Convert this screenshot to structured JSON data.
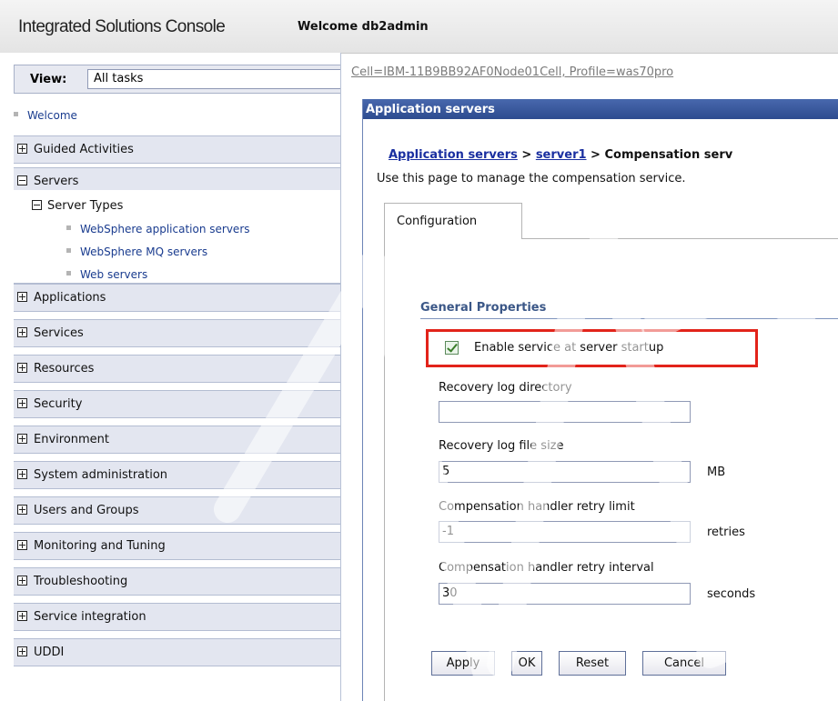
{
  "header": {
    "app_title": "Integrated Solutions Console",
    "welcome": "Welcome db2admin"
  },
  "nav": {
    "view_label": "View:",
    "view_value": "All tasks",
    "welcome_link": "Welcome",
    "groups": [
      {
        "label": "Guided Activities",
        "expanded": false
      },
      {
        "label": "Servers",
        "expanded": true
      },
      {
        "label": "Applications",
        "expanded": false
      },
      {
        "label": "Services",
        "expanded": false
      },
      {
        "label": "Resources",
        "expanded": false
      },
      {
        "label": "Security",
        "expanded": false
      },
      {
        "label": "Environment",
        "expanded": false
      },
      {
        "label": "System administration",
        "expanded": false
      },
      {
        "label": "Users and Groups",
        "expanded": false
      },
      {
        "label": "Monitoring and Tuning",
        "expanded": false
      },
      {
        "label": "Troubleshooting",
        "expanded": false
      },
      {
        "label": "Service integration",
        "expanded": false
      },
      {
        "label": "UDDI",
        "expanded": false
      }
    ],
    "server_types": {
      "label": "Server Types",
      "items": [
        "WebSphere application servers",
        "WebSphere MQ servers",
        "Web servers"
      ]
    }
  },
  "main": {
    "cell_path": "Cell=IBM-11B9BB92AF0Node01Cell, Profile=was70pro",
    "panel_title": "Application servers",
    "trail": {
      "link1": "Application servers",
      "sep1": " > ",
      "link2": "server1",
      "sep2": " > ",
      "current": "Compensation serv"
    },
    "description": "Use this page to manage the compensation service.",
    "tab_label": "Configuration",
    "general_properties": "General Properties",
    "enable_startup": {
      "label": "Enable service at server startup",
      "checked": true
    },
    "fields": {
      "recovery_log_dir": {
        "label": "Recovery log directory",
        "value": "",
        "unit": ""
      },
      "recovery_log_size": {
        "label": "Recovery log file size",
        "value": "5",
        "unit": "MB"
      },
      "retry_limit": {
        "label": "Compensation handler retry limit",
        "value": "-1",
        "unit": "retries"
      },
      "retry_interval": {
        "label": "Compensation handler retry interval",
        "value": "30",
        "unit": "seconds"
      }
    },
    "buttons": {
      "apply": "Apply",
      "ok": "OK",
      "reset": "Reset",
      "cancel": "Cancel"
    }
  },
  "colors": {
    "panel_title_bg": "#2d4b8f",
    "nav_group_bg": "#e3e6f0",
    "link": "#1a3c8f",
    "highlight_border": "#e2231a"
  }
}
